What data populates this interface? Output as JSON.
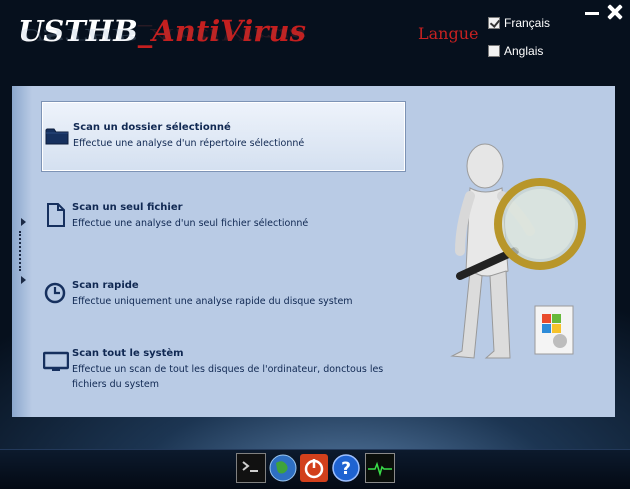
{
  "app": {
    "title_part1": "USTHB",
    "title_part2": "_AntiVirus"
  },
  "language": {
    "label": "Langue",
    "options": [
      {
        "label": "Français",
        "checked": true
      },
      {
        "label": "Anglais",
        "checked": false
      }
    ]
  },
  "scans": [
    {
      "title": "Scan un dossier sélectionné",
      "description": "Effectue une analyse d'un répertoire sélectionné",
      "icon": "folder-icon",
      "selected": true
    },
    {
      "title": "Scan un seul fichier",
      "description": "Effectue une analyse d'un seul fichier sélectionné",
      "icon": "file-icon",
      "selected": false
    },
    {
      "title": "Scan rapide",
      "description": "Effectue uniquement une analyse rapide du disque system",
      "icon": "clock-icon",
      "selected": false
    },
    {
      "title": "Scan tout le systèm",
      "description": "Effectue un scan de tout les disques de l'ordinateur, donctous les fichiers du system",
      "icon": "monitor-icon",
      "selected": false
    }
  ],
  "taskbar": [
    "terminal-icon",
    "globe-icon",
    "power-icon",
    "help-icon",
    "system-monitor-icon"
  ],
  "colors": {
    "title_accent": "#c41f1f",
    "panel_bg": "#b9cbe5",
    "text_dark": "#102852"
  }
}
